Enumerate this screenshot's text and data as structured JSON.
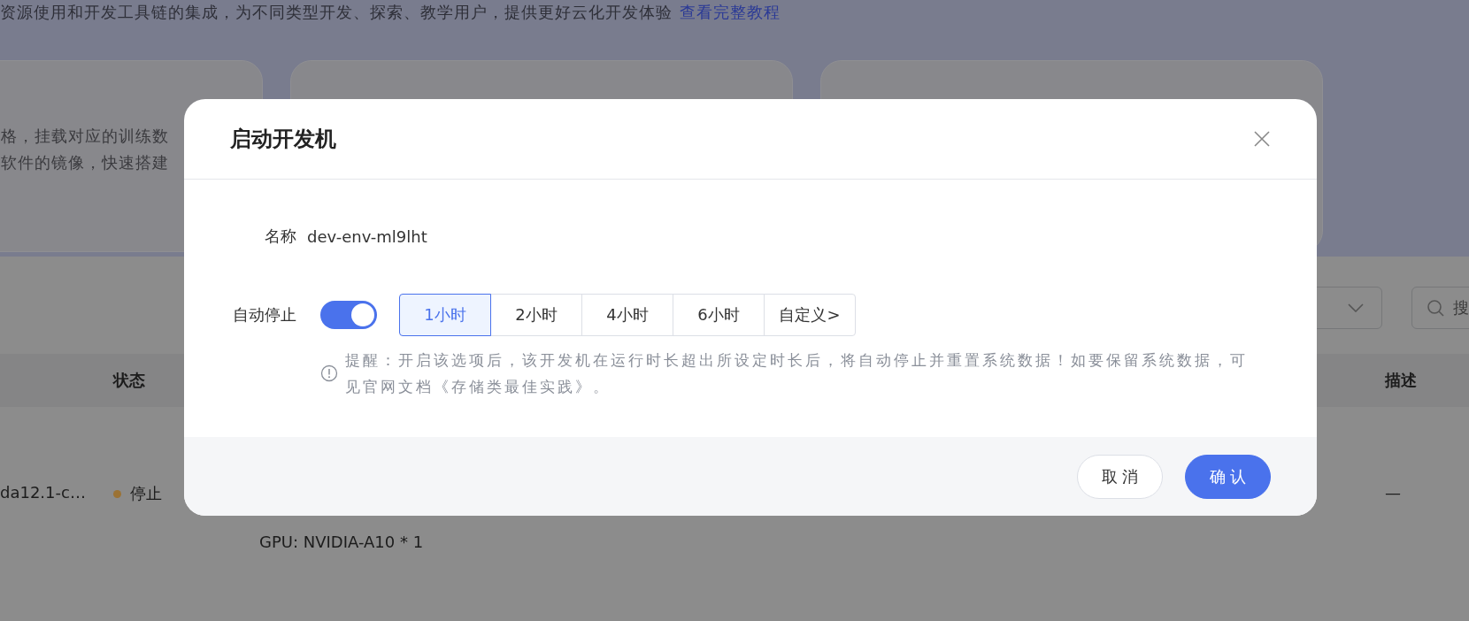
{
  "page": {
    "intro": "资源使用和开发工具链的集成，为不同类型开发、探索、教学用户，提供更好云化开发体验",
    "intro_link": "查看完整教程",
    "cards": [
      {
        "kind": "narrow",
        "lines": [
          "格，挂载对应的训练数",
          "软件的镜像，快速搭建"
        ]
      },
      {
        "kind": "wide"
      },
      {
        "kind": "wide"
      }
    ],
    "filters": {
      "search_placeholder": "搜"
    },
    "table": {
      "columns": [
        "",
        "状态",
        "",
        "",
        "描述"
      ],
      "rows": [
        {
          "name": "da12.1-c…",
          "status": "停止",
          "color": "#9b7234",
          "spec": "GPU: NVIDIA-A10 * 1",
          "description": "—"
        }
      ]
    }
  },
  "dialog": {
    "title": "启动开发机",
    "name_label": "名称",
    "name_value": "dev-env-ml9lht",
    "auto_stop": {
      "label": "自动停止",
      "on": true,
      "options": [
        {
          "label": "1小时",
          "selected": true
        },
        {
          "label": "2小时",
          "selected": false
        },
        {
          "label": "4小时",
          "selected": false
        },
        {
          "label": "6小时",
          "selected": false
        },
        {
          "label": "自定义>",
          "selected": false
        }
      ],
      "notice": "提醒：开启该选项后，该开发机在运行时长超出所设定时长后，将自动停止并重置系统数据！如要保留系统数据，可见官网文档《存储类最佳实践》。"
    },
    "buttons": [
      {
        "kind": "secondary",
        "label": "取 消"
      },
      {
        "kind": "primary",
        "label": "确 认"
      }
    ]
  }
}
